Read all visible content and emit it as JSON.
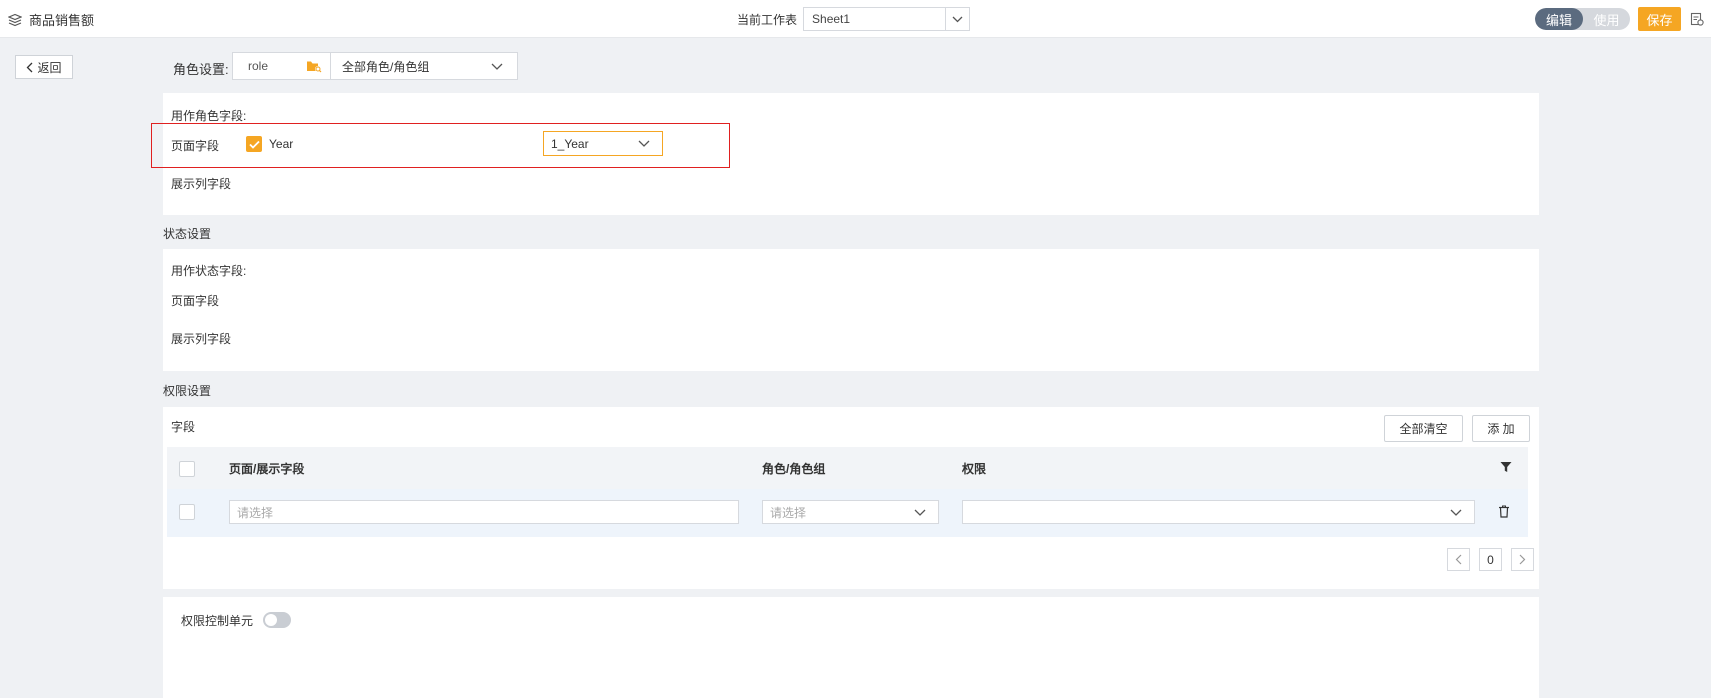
{
  "header": {
    "app_title": "商品销售额",
    "current_sheet_label": "当前工作表",
    "sheet_value": "Sheet1",
    "mode_edit": "编辑",
    "mode_use": "使用",
    "save_label": "保存"
  },
  "back_label": "返回",
  "role_settings": {
    "label": "角色设置:",
    "role_value": "role",
    "group_value": "全部角色/角色组"
  },
  "role_fields": {
    "title": "用作角色字段:",
    "page_field_label": "页面字段",
    "page_field_checked_item": "Year",
    "page_field_select_value": "1_Year",
    "display_field_label": "展示列字段"
  },
  "status_settings": {
    "section_title": "状态设置",
    "title": "用作状态字段:",
    "page_field_label": "页面字段",
    "display_field_label": "展示列字段"
  },
  "permission_settings": {
    "section_title": "权限设置",
    "field_label": "字段",
    "clear_all_label": "全部清空",
    "add_label": "添 加",
    "columns": [
      "页面/展示字段",
      "角色/角色组",
      "权限"
    ],
    "row": {
      "field_placeholder": "请选择",
      "role_placeholder": "请选择",
      "permission_value": ""
    },
    "page_number": "0"
  },
  "control_unit": {
    "label": "权限控制单元",
    "enabled": false
  },
  "colors": {
    "accent": "#f5a623",
    "highlight_border": "#e02020",
    "toggle_on": "#5b6b7f"
  }
}
